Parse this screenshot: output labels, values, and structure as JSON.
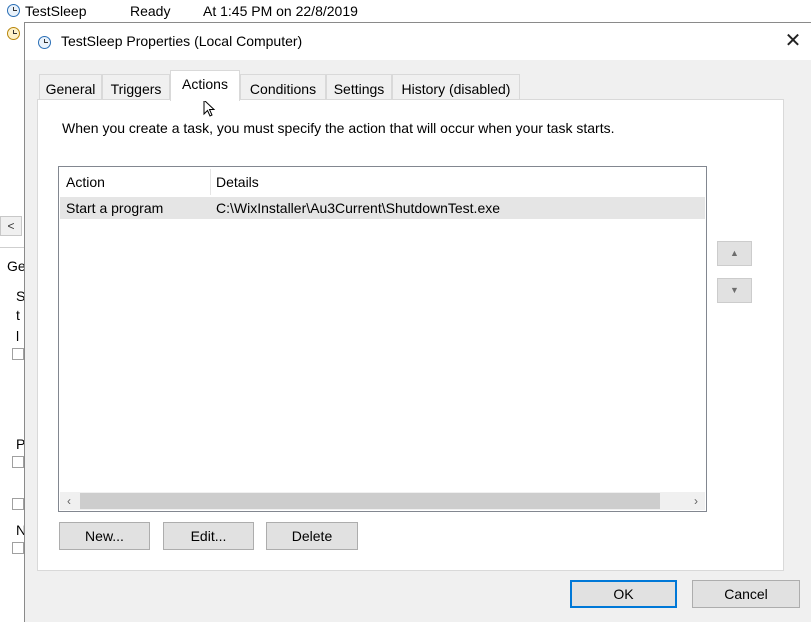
{
  "background": {
    "task_name": "TestSleep",
    "task_status": "Ready",
    "task_trigger": "At 1:45 PM on 22/8/2019",
    "scroll_left_arrow": "<",
    "tab_fragment": "Ge",
    "letters": [
      "S",
      "t",
      "l",
      "P",
      "N"
    ]
  },
  "dialog": {
    "title": "TestSleep Properties (Local Computer)",
    "close_glyph": "✕",
    "tabs": [
      {
        "label": "General"
      },
      {
        "label": "Triggers"
      },
      {
        "label": "Actions",
        "selected": true
      },
      {
        "label": "Conditions"
      },
      {
        "label": "Settings"
      },
      {
        "label": "History (disabled)"
      }
    ],
    "description": "When you create a task, you must specify the action that will occur when your task starts.",
    "list": {
      "columns": [
        "Action",
        "Details"
      ],
      "rows": [
        {
          "action": "Start a program",
          "details": "C:\\WixInstaller\\Au3Current\\ShutdownTest.exe",
          "selected": true
        }
      ],
      "scroll_left": "‹",
      "scroll_right": "›"
    },
    "move_up_glyph": "▲",
    "move_down_glyph": "▼",
    "buttons": {
      "new": "New...",
      "edit": "Edit...",
      "delete": "Delete",
      "ok": "OK",
      "cancel": "Cancel"
    }
  }
}
